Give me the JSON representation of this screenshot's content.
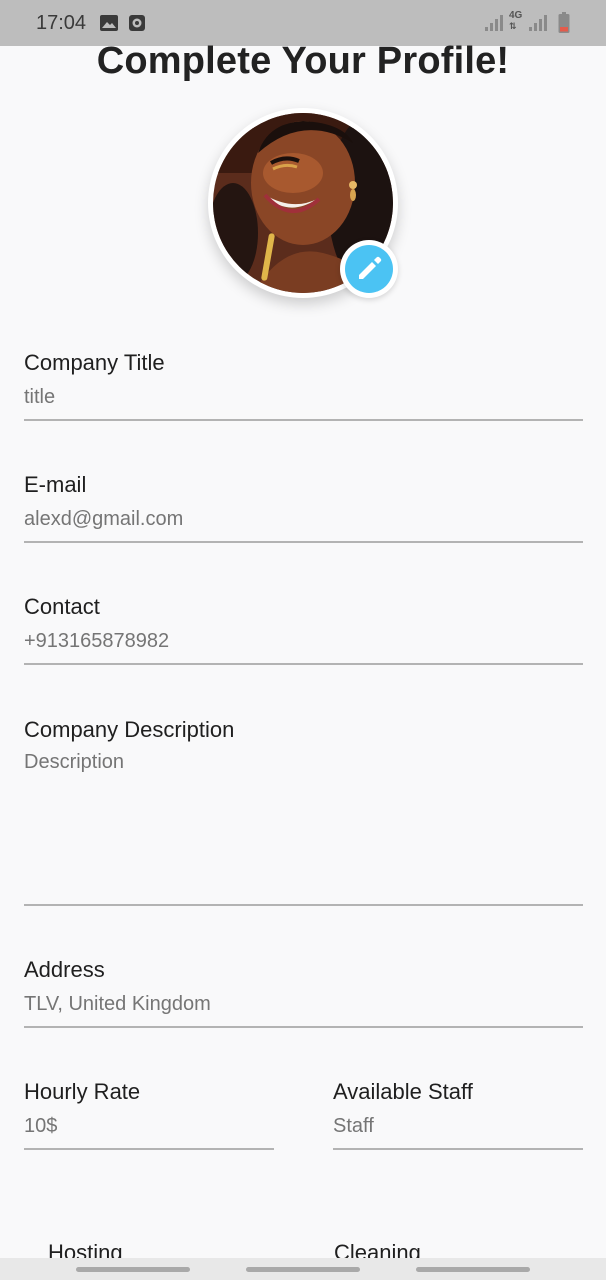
{
  "status_bar": {
    "time": "17:04",
    "icons": [
      "image-icon",
      "alarm-icon",
      "signal-icon",
      "network-4g-icon",
      "signal-icon",
      "battery-icon"
    ],
    "network_label": "4G"
  },
  "page": {
    "title": "Complete Your Profile!"
  },
  "avatar": {
    "edit_icon": "pencil-icon",
    "accent_color": "#4bc3f3"
  },
  "form": {
    "company_title": {
      "label": "Company Title",
      "placeholder": "title"
    },
    "email": {
      "label": "E-mail",
      "placeholder": "alexd@gmail.com"
    },
    "contact": {
      "label": "Contact",
      "placeholder": "+913165878982"
    },
    "description": {
      "label": "Company Description",
      "placeholder": "Description"
    },
    "address": {
      "label": "Address",
      "placeholder": "TLV, United Kingdom"
    },
    "hourly_rate": {
      "label": "Hourly Rate",
      "placeholder": "10$"
    },
    "available_staff": {
      "label": "Available Staff",
      "placeholder": "Staff"
    }
  },
  "services": {
    "items": [
      "Hosting",
      "Cleaning"
    ]
  }
}
